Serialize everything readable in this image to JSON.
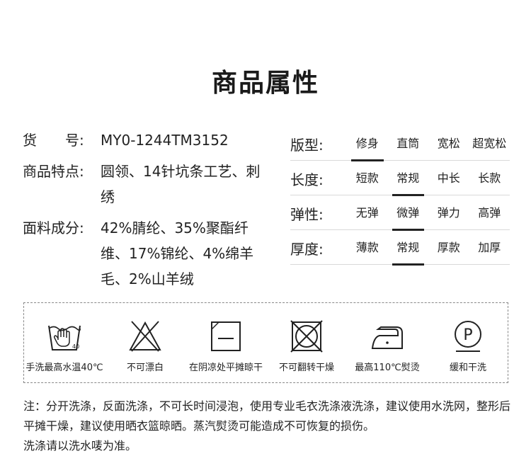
{
  "title": "商品属性",
  "info": {
    "sku_label": "货　　号:",
    "sku_value": "MY0-1244TM3152",
    "features_label": "商品特点:",
    "features_value": "圆领、14针坑条工艺、刺绣",
    "fabric_label": "面料成分:",
    "fabric_value": "42%腈纶、35%聚酯纤维、17%锦纶、4%绵羊毛、2%山羊绒"
  },
  "attributes": [
    {
      "label": "版型:",
      "options": [
        "修身",
        "直筒",
        "宽松",
        "超宽松"
      ],
      "selected_index": 0
    },
    {
      "label": "长度:",
      "options": [
        "短款",
        "常规",
        "中长",
        "长款"
      ],
      "selected_index": 1
    },
    {
      "label": "弹性:",
      "options": [
        "无弹",
        "微弹",
        "弹力",
        "高弹"
      ],
      "selected_index": 1
    },
    {
      "label": "厚度:",
      "options": [
        "薄款",
        "常规",
        "厚款",
        "加厚"
      ],
      "selected_index": 1
    }
  ],
  "care": [
    {
      "icon": "hand-wash-icon",
      "label": "手洗最高水温40℃",
      "wash_temp": "40"
    },
    {
      "icon": "no-bleach-icon",
      "label": "不可漂白"
    },
    {
      "icon": "shade-dry-flat-icon",
      "label": "在阴凉处平摊晾干"
    },
    {
      "icon": "no-tumble-dry-icon",
      "label": "不可翻转干燥"
    },
    {
      "icon": "iron-110-icon",
      "label": "最高110℃熨烫"
    },
    {
      "icon": "professional-dry-clean-icon",
      "label": "缓和干洗",
      "symbol": "P"
    }
  ],
  "note": {
    "line1": "注：分开洗涤，反面洗涤，不可长时间浸泡，使用专业毛衣洗涤液洗涤，建议使用水洗网，整形后平摊干燥，建议使用晒衣篮晾晒。蒸汽熨烫可能造成不可恢复的损伤。",
    "line2": "洗涤请以洗水唛为准。"
  }
}
